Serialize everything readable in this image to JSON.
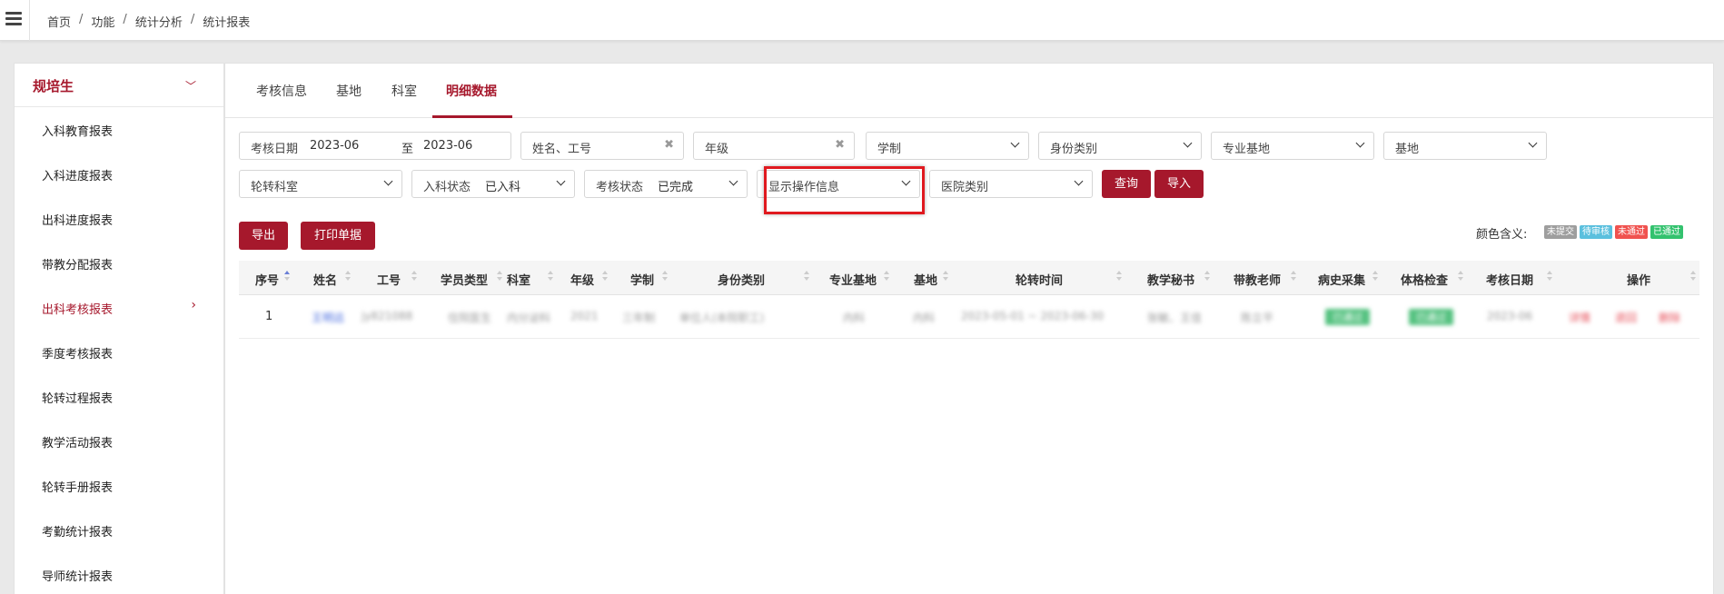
{
  "breadcrumb": [
    "首页",
    "功能",
    "统计分析",
    "统计报表"
  ],
  "sidebar": {
    "title": "规培生",
    "items": [
      {
        "label": "入科教育报表"
      },
      {
        "label": "入科进度报表"
      },
      {
        "label": "出科进度报表"
      },
      {
        "label": "带教分配报表"
      },
      {
        "label": "出科考核报表"
      },
      {
        "label": "季度考核报表"
      },
      {
        "label": "轮转过程报表"
      },
      {
        "label": "教学活动报表"
      },
      {
        "label": "轮转手册报表"
      },
      {
        "label": "考勤统计报表"
      },
      {
        "label": "导师统计报表"
      }
    ]
  },
  "tabs": [
    "考核信息",
    "基地",
    "科室",
    "明细数据"
  ],
  "filters": {
    "date_label": "考核日期",
    "date_from": "2023-06",
    "date_to_sep": "至",
    "date_to": "2023-06",
    "name_placeholder": "姓名、工号",
    "grade_placeholder": "年级",
    "xuezhi": "学制",
    "identity": "身份类别",
    "major_base": "专业基地",
    "base": "基地",
    "rotation_dept": "轮转科室",
    "entry_status_label": "入科状态",
    "entry_status": "已入科",
    "exam_status_label": "考核状态",
    "exam_status": "已完成",
    "show_ops": "显示操作信息",
    "hospital_type": "医院类别"
  },
  "buttons": {
    "query": "查询",
    "import": "导入",
    "export": "导出",
    "print": "打印单据"
  },
  "legend": {
    "label": "颜色含义:",
    "items": [
      {
        "text": "未提交",
        "color": "#9e9e9e"
      },
      {
        "text": "待审核",
        "color": "#5bc0de"
      },
      {
        "text": "未通过",
        "color": "#f0524f"
      },
      {
        "text": "已通过",
        "color": "#33c26e"
      }
    ]
  },
  "table": {
    "headers": [
      "序号",
      "姓名",
      "工号",
      "学员类型",
      "科室",
      "年级",
      "学制",
      "身份类别",
      "专业基地",
      "基地",
      "轮转时间",
      "教学秘书",
      "带教老师",
      "病史采集",
      "体格检查",
      "考核日期",
      "操作"
    ],
    "rows": [
      {
        "no": "1",
        "name": "王明远",
        "id": "jy821088",
        "type": "住院医生",
        "dept": "内分泌科",
        "grade": "2021",
        "xuezhi": "三年制",
        "identity": "单位人(本院职工)",
        "major_base": "内科",
        "base": "内科",
        "rotation": "2023-05-01 ~ 2023-06-30",
        "secretary": "张敏、王佳",
        "teacher": "陈立平",
        "history": "已通过",
        "physical": "已通过",
        "exam_date": "2023-06",
        "op1": "详情",
        "op2": "退回",
        "op3": "删除"
      }
    ]
  }
}
